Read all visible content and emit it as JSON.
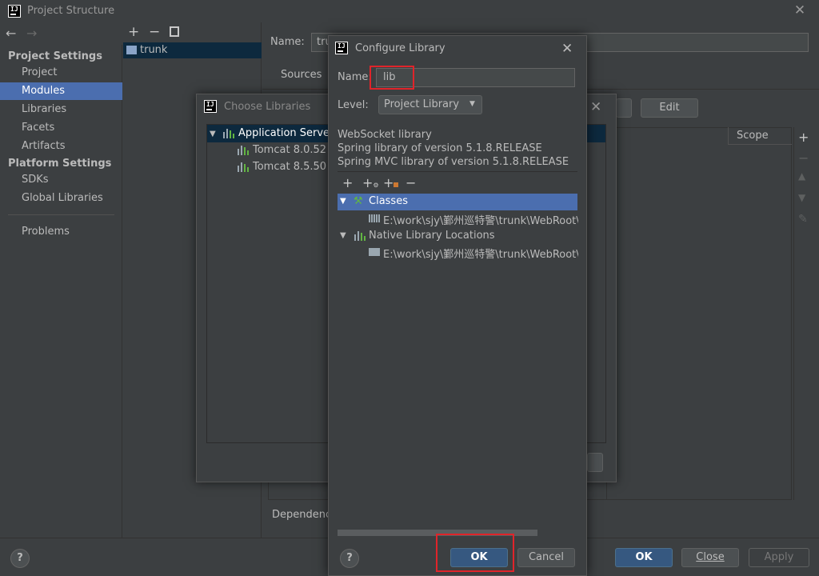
{
  "window": {
    "title": "Project Structure"
  },
  "nav": {
    "back": "←",
    "forward": "→"
  },
  "sidebar": {
    "project_settings_header": "Project Settings",
    "platform_settings_header": "Platform Settings",
    "items": [
      {
        "label": "Project"
      },
      {
        "label": "Modules",
        "selected": true
      },
      {
        "label": "Libraries"
      },
      {
        "label": "Facets"
      },
      {
        "label": "Artifacts"
      },
      {
        "label": "SDKs"
      },
      {
        "label": "Global Libraries"
      },
      {
        "label": "Problems"
      }
    ]
  },
  "modules_panel": {
    "toolbar": {
      "add": "+",
      "remove": "−"
    },
    "modules": [
      "trunk"
    ]
  },
  "module_editor": {
    "name_label": "Name:",
    "name_value": "tru",
    "tab_sources": "Sources",
    "edit_button": "Edit",
    "scope_header": "Scope",
    "dependencies_label": "Dependenci"
  },
  "bottom": {
    "help": "?",
    "ok": "OK",
    "close": "Close",
    "apply": "Apply"
  },
  "choose_libraries": {
    "title": "Choose Libraries",
    "tree": {
      "root": "Application Server",
      "children": [
        "Tomcat 8.0.52",
        "Tomcat 8.5.50"
      ]
    }
  },
  "configure_library": {
    "title": "Configure Library",
    "name_label": "Name:",
    "name_value": "lib",
    "level_label": "Level:",
    "level_value": "Project Library",
    "descriptions": [
      "WebSocket library",
      "Spring library of version 5.1.8.RELEASE",
      "Spring MVC library of version 5.1.8.RELEASE"
    ],
    "roots": [
      {
        "label": "Classes",
        "path": "E:\\work\\sjy\\鄞州巡特警\\trunk\\WebRoot\\WI"
      },
      {
        "label": "Native Library Locations",
        "path": "E:\\work\\sjy\\鄞州巡特警\\trunk\\WebRoot\\WI"
      }
    ],
    "help": "?",
    "ok": "OK",
    "cancel": "Cancel"
  },
  "colors": {
    "background": "#3c3f41",
    "selection": "#4b6eaf",
    "default_button": "#365880",
    "highlight_box": "#e0242a"
  }
}
